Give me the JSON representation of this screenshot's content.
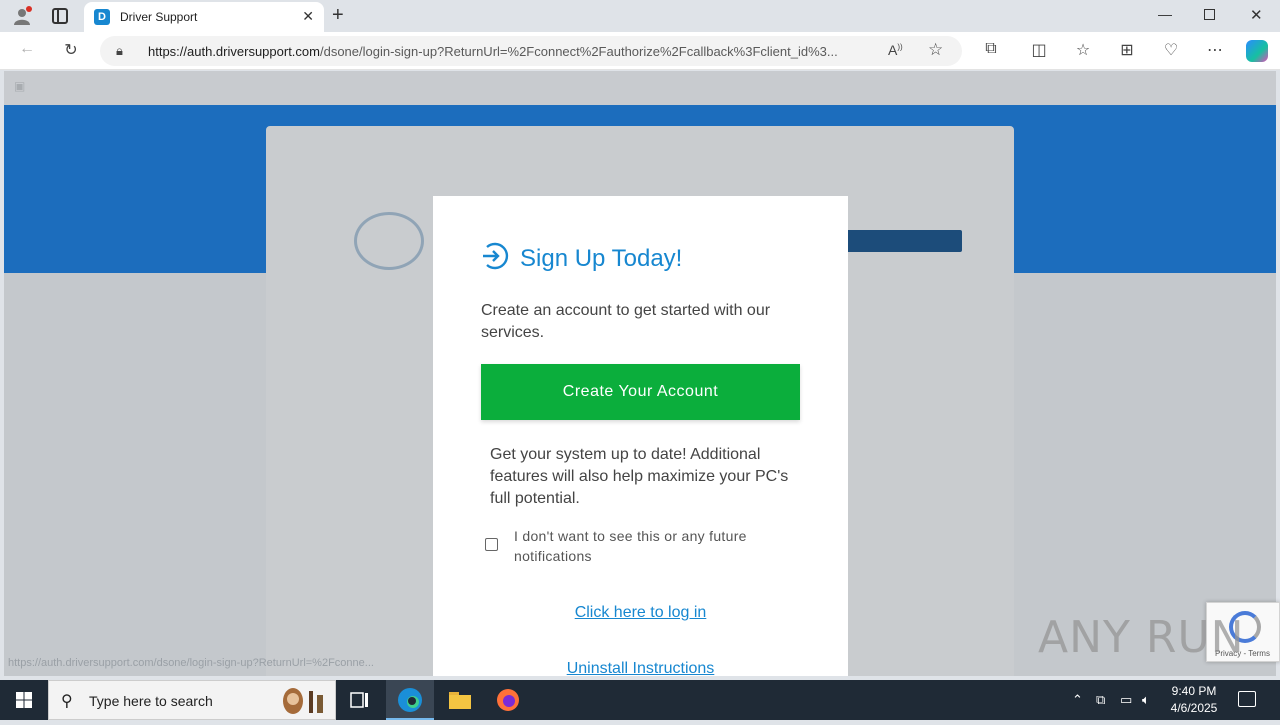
{
  "browser": {
    "tab_title": "Driver Support",
    "tab_favicon": "D",
    "url_host": "https://auth.driversupport.com",
    "url_path": "/dsone/login-sign-up?ReturnUrl=%2Fconnect%2Fauthorize%2Fcallback%3Fclient_id%3..."
  },
  "background_page": {
    "status_url": "https://auth.driversupport.com/dsone/login-sign-up?ReturnUrl=%2Fconne..."
  },
  "modal": {
    "title": "Sign Up Today!",
    "description": "Create an account to get started with our services.",
    "create_button": "Create Your Account",
    "promo": "Get your system up to date! Additional features will also help maximize your PC's full potential.",
    "checkbox_label": "I don't want to see this or any future notifications",
    "login_link": "Click here to log in",
    "uninstall_link": "Uninstall Instructions",
    "accent_color": "#1787d0",
    "button_color": "#0bae3c"
  },
  "recaptcha": {
    "terms": "Privacy - Terms"
  },
  "watermark": "ANY RUN",
  "taskbar": {
    "search_placeholder": "Type here to search",
    "time": "9:40 PM",
    "date": "4/6/2025"
  }
}
